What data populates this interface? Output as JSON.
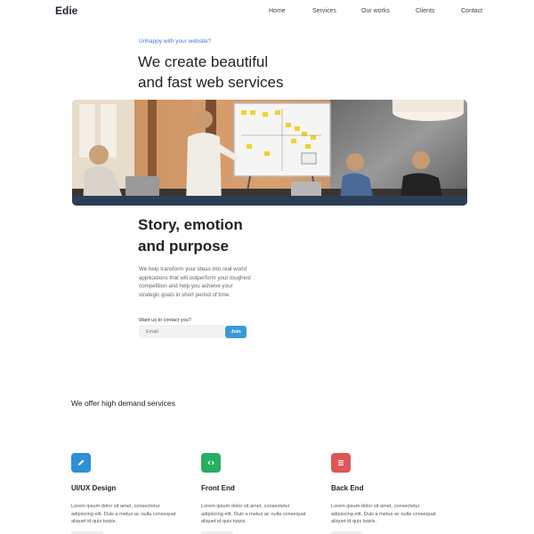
{
  "header": {
    "logo": "Edie",
    "nav": [
      "Home",
      "Services",
      "Our works",
      "Clients",
      "Contact"
    ]
  },
  "hero": {
    "eyebrow": "Unhappy with your website?",
    "title_line1": "We create beautiful",
    "title_line2": "and fast web services"
  },
  "story": {
    "title_line1": "Story, emotion",
    "title_line2": "and purpose",
    "text": "We help transform your ideas into real world applications that will outperform your toughest competition and help you achieve your strategic goals in short period of time.",
    "contact_label": "Want us to contact you?",
    "email_placeholder": "Email",
    "join_label": "Join"
  },
  "offer": {
    "title": "We offer high demand services",
    "services": [
      {
        "name": "UI/UX Design",
        "icon": "pencil-icon",
        "color": "#2f8fd8",
        "desc": "Lorem ipsum dolor sit amet, consectetur adipiscing elit. Duis a metus ac nulla consequat aliquet id quis turpis."
      },
      {
        "name": "Front End",
        "icon": "code-icon",
        "color": "#27ae60",
        "desc": "Lorem ipsum dolor sit amet, consectetur adipiscing elit. Duis a metus ac nulla consequat aliquet id quis turpis."
      },
      {
        "name": "Back End",
        "icon": "list-icon",
        "color": "#e05656",
        "desc": "Lorem ipsum dolor sit amet, consectetur adipiscing elit. Duis a metus ac nulla consequat aliquet id quis turpis."
      }
    ]
  }
}
